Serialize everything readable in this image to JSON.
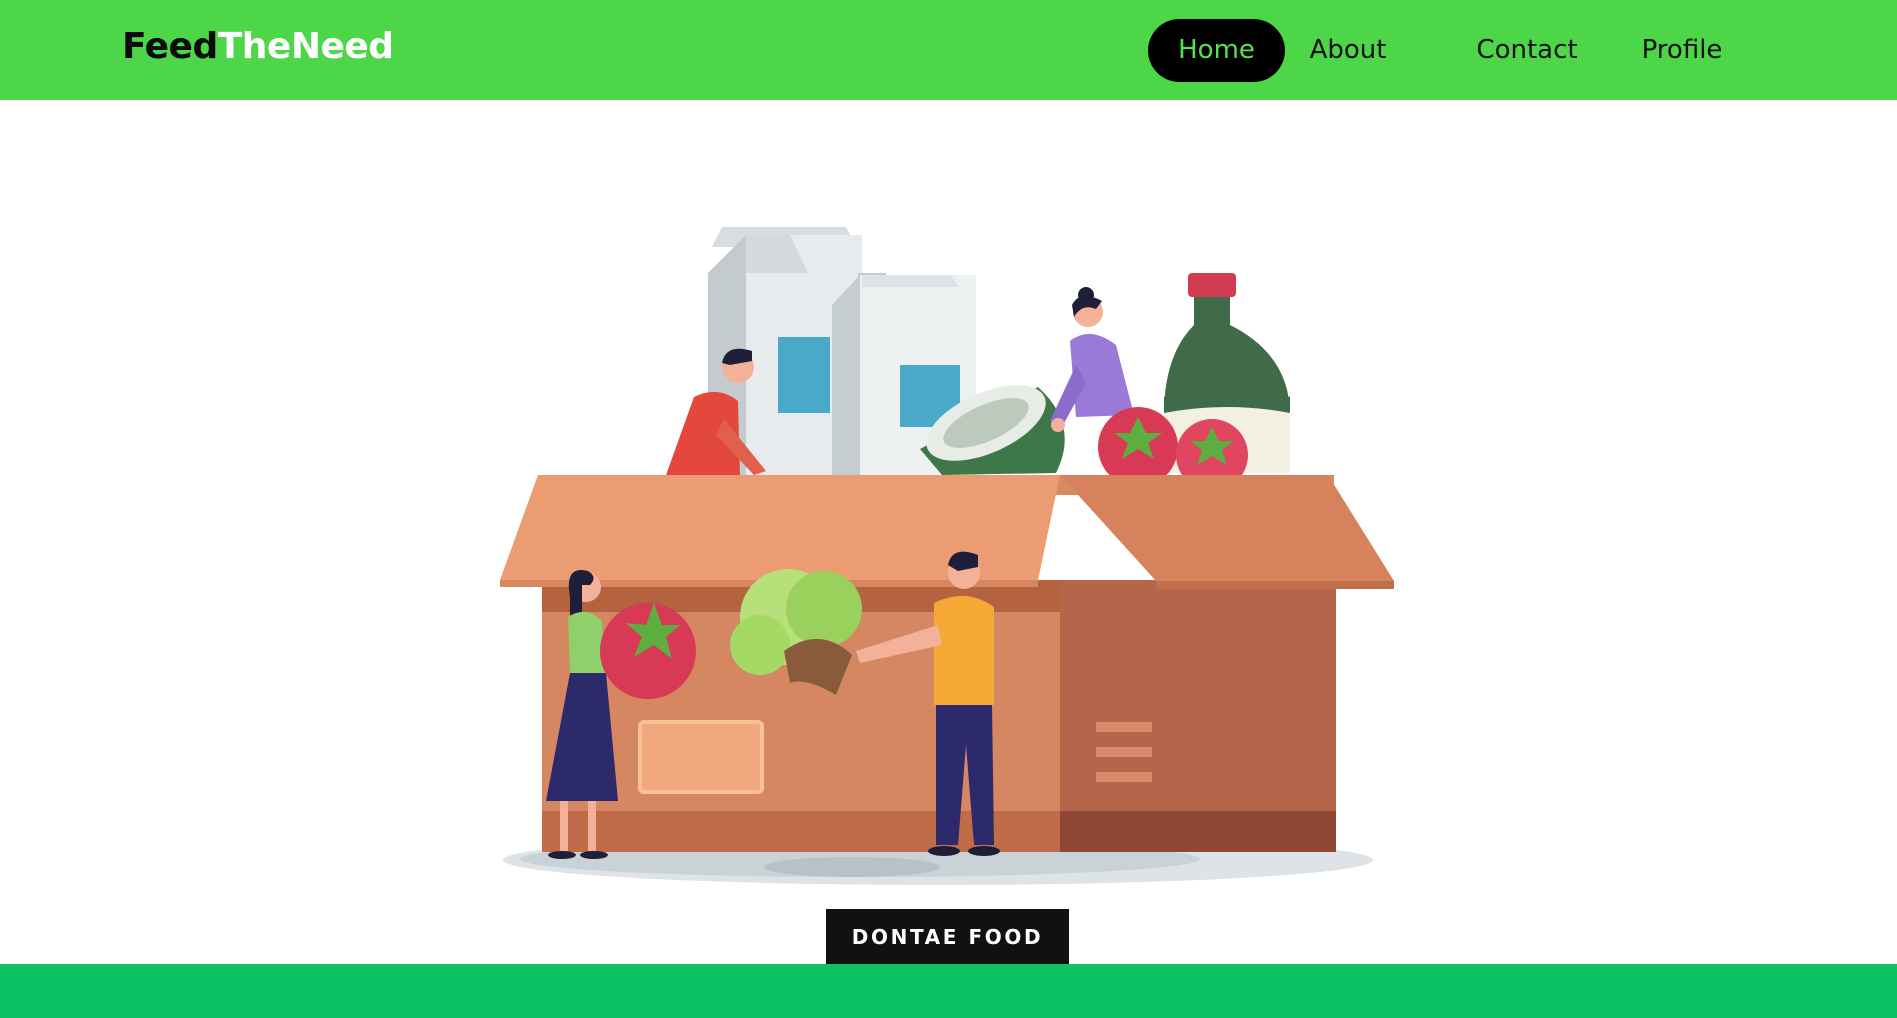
{
  "brand": {
    "part1": "Feed",
    "part2": "TheNeed"
  },
  "nav": {
    "items": [
      {
        "label": "Home",
        "active": true
      },
      {
        "label": "About",
        "active": false
      },
      {
        "label": "Contact",
        "active": false
      },
      {
        "label": "Profile",
        "active": false
      }
    ]
  },
  "hero": {
    "illustration": "food-donation-box-illustration",
    "cta_label": "DONTAE FOOD"
  },
  "colors": {
    "navbar": "#4cd648",
    "nav_active_bg": "#000000",
    "nav_active_text": "#58e14f",
    "footer": "#0ac464",
    "cta_bg": "#111111"
  }
}
